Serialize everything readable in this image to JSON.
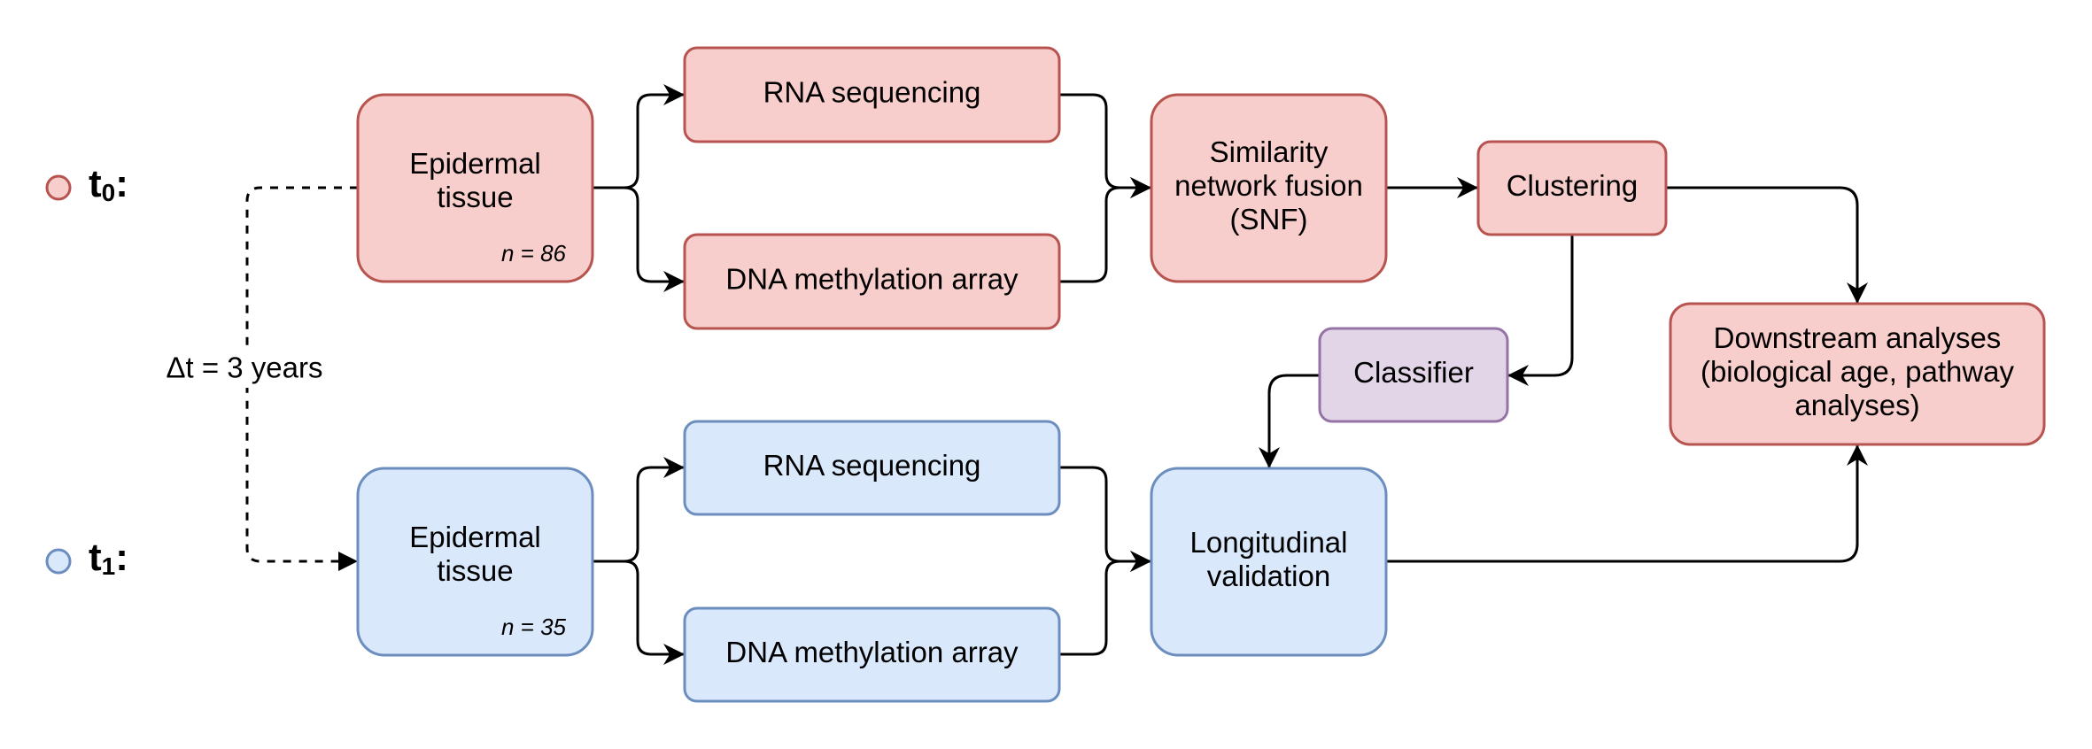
{
  "colors": {
    "t0_fill": "#f8cecc",
    "t0_stroke": "#b85450",
    "t1_fill": "#dae8fc",
    "t1_stroke": "#6c8ebf",
    "classifier_fill": "#e1d5e7",
    "classifier_stroke": "#9673a6"
  },
  "timepoints": {
    "t0": {
      "base": "t",
      "sub": "0",
      "suffix": ":"
    },
    "t1": {
      "base": "t",
      "sub": "1",
      "suffix": ":"
    },
    "delta": "Δt = 3 years"
  },
  "nodes": {
    "epidermal_t0": {
      "lines": [
        "Epidermal",
        "tissue"
      ],
      "n": "n = 86"
    },
    "rna_t0": {
      "lines": [
        "RNA sequencing"
      ]
    },
    "dna_t0": {
      "lines": [
        "DNA methylation array"
      ]
    },
    "snf": {
      "lines": [
        "Similarity",
        "network fusion",
        "(SNF)"
      ]
    },
    "clustering": {
      "lines": [
        "Clustering"
      ]
    },
    "classifier": {
      "lines": [
        "Classifier"
      ]
    },
    "downstream": {
      "lines": [
        "Downstream analyses",
        "(biological age, pathway",
        "analyses)"
      ]
    },
    "epidermal_t1": {
      "lines": [
        "Epidermal",
        "tissue"
      ],
      "n": "n = 35"
    },
    "rna_t1": {
      "lines": [
        "RNA sequencing"
      ]
    },
    "dna_t1": {
      "lines": [
        "DNA methylation array"
      ]
    },
    "longitudinal": {
      "lines": [
        "Longitudinal",
        "validation"
      ]
    }
  }
}
